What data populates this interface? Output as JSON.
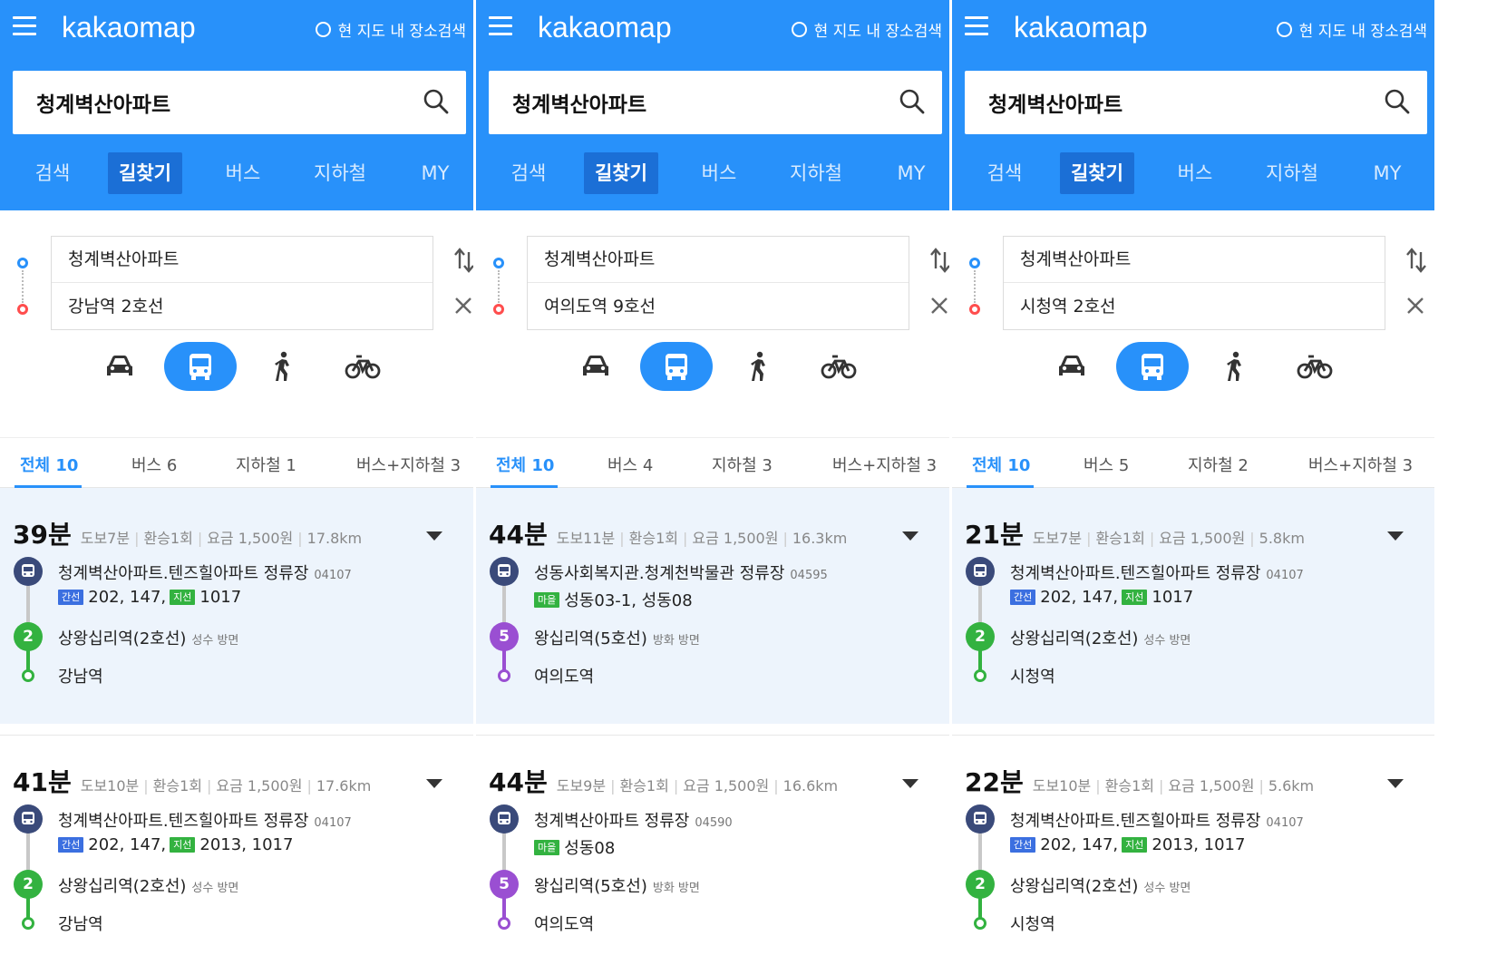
{
  "app": {
    "logo": "kakaomap",
    "map_search_label": "현 지도 내 장소검색",
    "search_query": "청계벽산아파트",
    "tabs": [
      "검색",
      "길찾기",
      "버스",
      "지하철",
      "MY"
    ],
    "active_tab": "길찾기"
  },
  "colors": {
    "header_blue": "#2891fa",
    "active_tab": "#1b6fd6",
    "line2_green": "#33b240",
    "line5_purple": "#9a4fd2",
    "bus_navy": "#3a4a7a",
    "trunk_badge": "#3b6fe0",
    "branch_badge": "#33b240"
  },
  "icons": [
    "menu-icon",
    "search-icon",
    "swap-icon",
    "close-icon",
    "car-icon",
    "bus-icon",
    "walk-icon",
    "bike-icon",
    "chevron-down-icon"
  ],
  "panels": [
    {
      "origin": "청계벽산아파트",
      "destination": "강남역 2호선",
      "categories": {
        "all": "전체 10",
        "bus": "버스 6",
        "subway": "지하철 1",
        "bus_subway": "버스+지하철 3"
      },
      "results": [
        {
          "minutes": "39분",
          "walk": "도보7분",
          "transfer": "환승1회",
          "fare": "요금 1,500원",
          "distance": "17.8km",
          "board_stop": "청계벽산아파트.텐즈힐아파트 정류장",
          "board_stop_id": "04107",
          "badge1": "간선",
          "routes1": "202, 147,",
          "badge2": "지선",
          "routes2": "1017",
          "transfer_line": "2",
          "transfer_station": "상왕십리역(2호선)",
          "direction": "성수 방면",
          "arrival": "강남역"
        },
        {
          "minutes": "41분",
          "walk": "도보10분",
          "transfer": "환승1회",
          "fare": "요금 1,500원",
          "distance": "17.6km",
          "board_stop": "청계벽산아파트.텐즈힐아파트 정류장",
          "board_stop_id": "04107",
          "badge1": "간선",
          "routes1": "202, 147,",
          "badge2": "지선",
          "routes2": "2013, 1017",
          "transfer_line": "2",
          "transfer_station": "상왕십리역(2호선)",
          "direction": "성수 방면",
          "arrival": "강남역"
        }
      ]
    },
    {
      "origin": "청계벽산아파트",
      "destination": "여의도역 9호선",
      "categories": {
        "all": "전체 10",
        "bus": "버스 4",
        "subway": "지하철 3",
        "bus_subway": "버스+지하철 3"
      },
      "results": [
        {
          "minutes": "44분",
          "walk": "도보11분",
          "transfer": "환승1회",
          "fare": "요금 1,500원",
          "distance": "16.3km",
          "board_stop": "성동사회복지관.청계천박물관 정류장",
          "board_stop_id": "04595",
          "badge1": "마을",
          "routes1": "성동03-1, 성동08",
          "badge2": "",
          "routes2": "",
          "transfer_line": "5",
          "transfer_station": "왕십리역(5호선)",
          "direction": "방화 방면",
          "arrival": "여의도역"
        },
        {
          "minutes": "44분",
          "walk": "도보9분",
          "transfer": "환승1회",
          "fare": "요금 1,500원",
          "distance": "16.6km",
          "board_stop": "청계벽산아파트 정류장",
          "board_stop_id": "04590",
          "badge1": "마을",
          "routes1": "성동08",
          "badge2": "",
          "routes2": "",
          "transfer_line": "5",
          "transfer_station": "왕십리역(5호선)",
          "direction": "방화 방면",
          "arrival": "여의도역"
        }
      ]
    },
    {
      "origin": "청계벽산아파트",
      "destination": "시청역 2호선",
      "categories": {
        "all": "전체 10",
        "bus": "버스 5",
        "subway": "지하철 2",
        "bus_subway": "버스+지하철 3"
      },
      "results": [
        {
          "minutes": "21분",
          "walk": "도보7분",
          "transfer": "환승1회",
          "fare": "요금 1,500원",
          "distance": "5.8km",
          "board_stop": "청계벽산아파트.텐즈힐아파트 정류장",
          "board_stop_id": "04107",
          "badge1": "간선",
          "routes1": "202, 147,",
          "badge2": "지선",
          "routes2": "1017",
          "transfer_line": "2",
          "transfer_station": "상왕십리역(2호선)",
          "direction": "성수 방면",
          "arrival": "시청역"
        },
        {
          "minutes": "22분",
          "walk": "도보10분",
          "transfer": "환승1회",
          "fare": "요금 1,500원",
          "distance": "5.6km",
          "board_stop": "청계벽산아파트.텐즈힐아파트 정류장",
          "board_stop_id": "04107",
          "badge1": "간선",
          "routes1": "202, 147,",
          "badge2": "지선",
          "routes2": "2013, 1017",
          "transfer_line": "2",
          "transfer_station": "상왕십리역(2호선)",
          "direction": "성수 방면",
          "arrival": "시청역"
        }
      ]
    }
  ]
}
